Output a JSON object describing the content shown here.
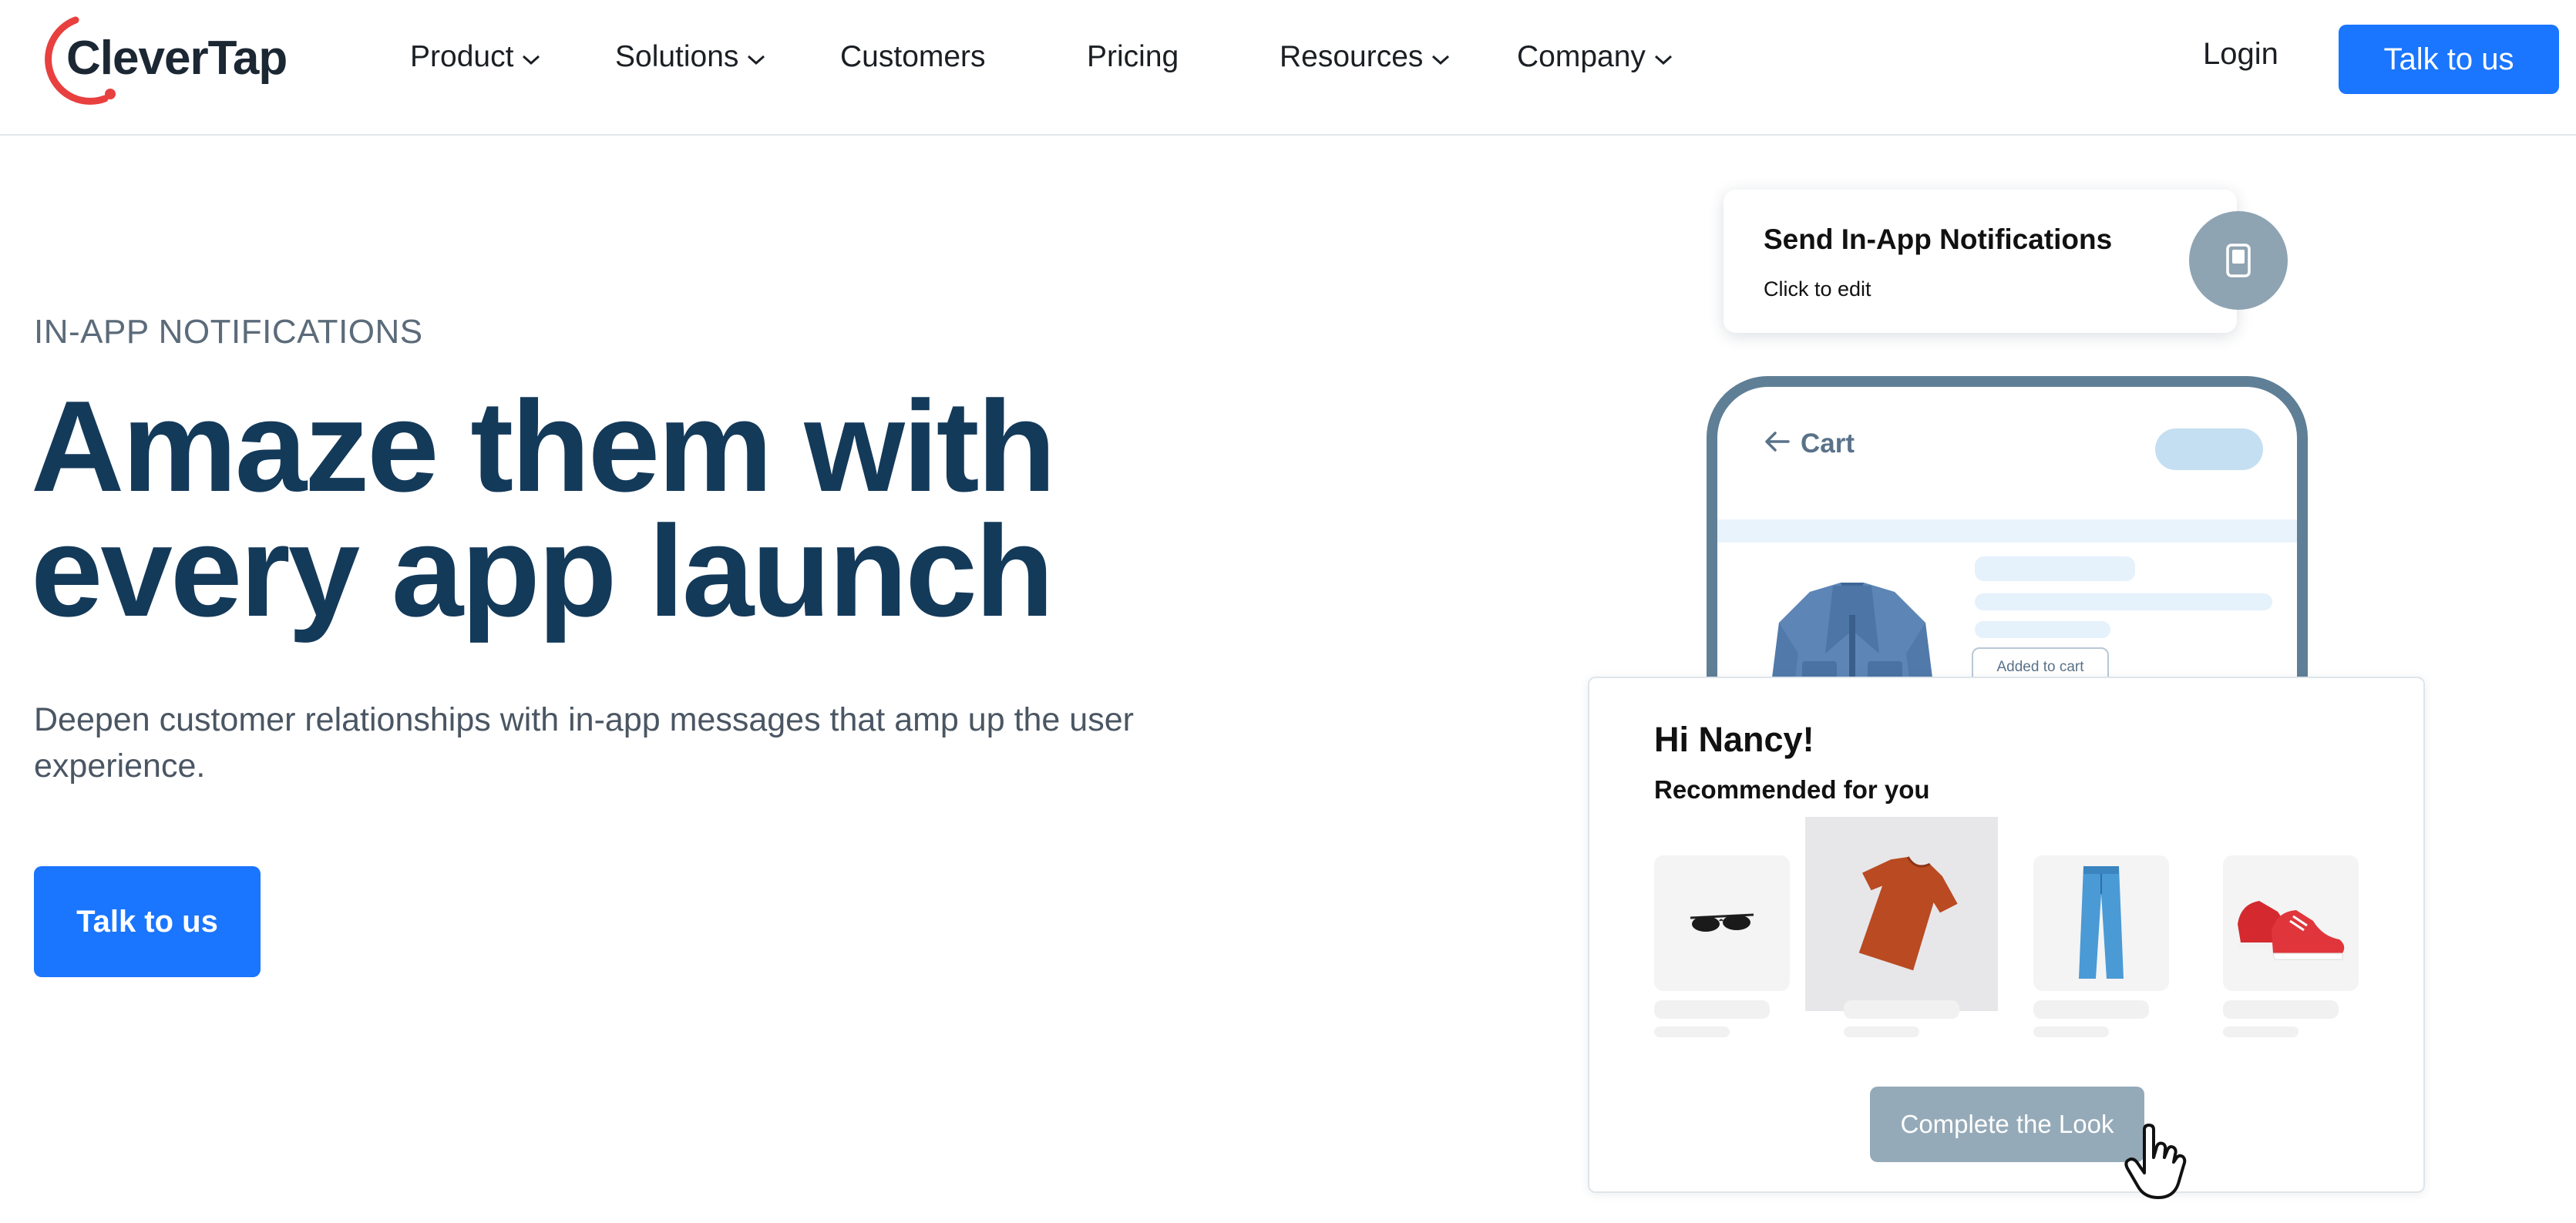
{
  "brand": {
    "name": "CleverTap",
    "accent": "#e8403f",
    "primary": "#1a75ff",
    "headline_color": "#143a5a"
  },
  "nav": {
    "items": [
      {
        "label": "Product",
        "has_dropdown": true
      },
      {
        "label": "Solutions",
        "has_dropdown": true
      },
      {
        "label": "Customers",
        "has_dropdown": false
      },
      {
        "label": "Pricing",
        "has_dropdown": false
      },
      {
        "label": "Resources",
        "has_dropdown": true
      },
      {
        "label": "Company",
        "has_dropdown": true
      }
    ],
    "login_label": "Login",
    "cta_label": "Talk to us"
  },
  "hero": {
    "eyebrow": "IN-APP NOTIFICATIONS",
    "headline_line1": "Amaze them with",
    "headline_line2": "every app launch",
    "subtext": "Deepen customer relationships with in-app messages that amp up the user experience.",
    "cta_label": "Talk to us"
  },
  "illustration": {
    "notification_card": {
      "title": "Send In-App Notifications",
      "subtitle": "Click to edit",
      "icon": "phone-icon"
    },
    "phone": {
      "title": "Cart",
      "back_icon": "arrow-left-icon",
      "added_label": "Added to cart"
    },
    "recommendation": {
      "greeting": "Hi Nancy!",
      "subtitle": "Recommended for you",
      "products": [
        "sunglasses",
        "t-shirt",
        "jeans",
        "sneakers"
      ],
      "button_label": "Complete the Look",
      "cursor_icon": "hand-pointer-icon"
    }
  }
}
